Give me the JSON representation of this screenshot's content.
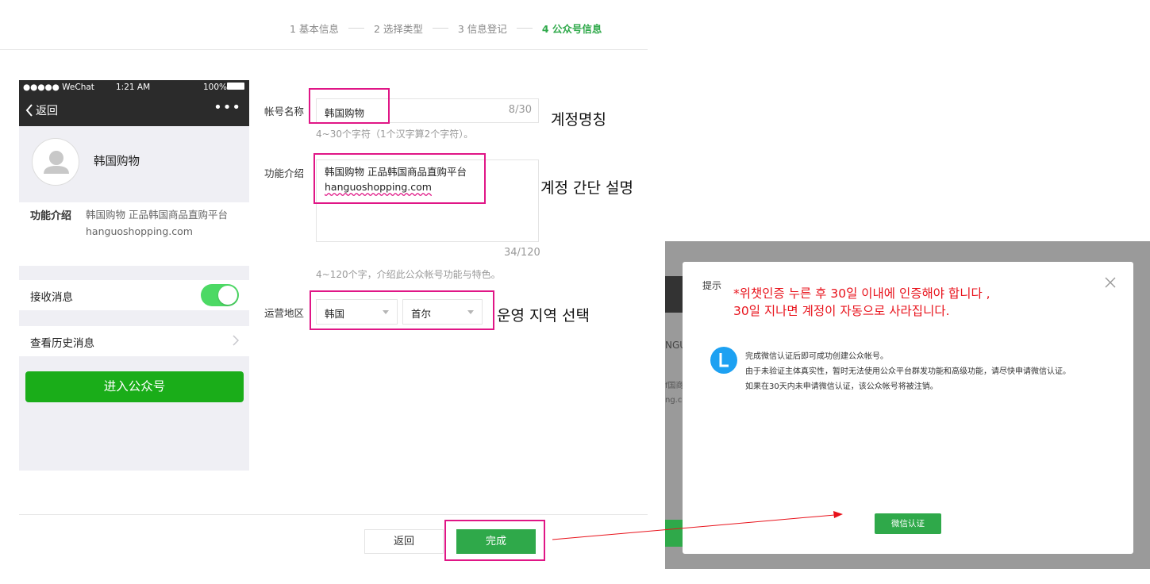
{
  "stepper": {
    "step1": "1 基本信息",
    "step2": "2 选择类型",
    "step3": "3 信息登记",
    "step4": "4 公众号信息"
  },
  "phone": {
    "carrier": "●●●●● WeChat",
    "time": "1:21 AM",
    "battery": "100%",
    "back_label": "返回",
    "more": "•••",
    "account_name": "韩国购物",
    "intro_label": "功能介绍",
    "intro_line1": "韩国购物 正品韩国商品直购平台",
    "intro_line2": "hanguoshopping.com",
    "receive_messages": "接收消息",
    "toggle_on": true,
    "history": "查看历史消息",
    "enter_button": "进入公众号"
  },
  "form": {
    "name_label": "帐号名称",
    "name_value": "韩国购物",
    "name_counter": "8/30",
    "name_hint": "4~30个字符（1个汉字算2个字符）。",
    "intro_label": "功能介绍",
    "intro_line1": "韩国购物 正品韩国商品直购平台",
    "intro_line2": "hanguoshopping.com",
    "intro_counter": "34/120",
    "intro_hint": "4~120个字，介绍此公众帐号功能与特色。",
    "region_label": "运营地区",
    "country": "韩国",
    "city": "首尔",
    "back_button": "返回",
    "done_button": "完成"
  },
  "annotations": {
    "name_note": "계정명칭",
    "intro_note": "계정 간단 설명",
    "region_note": "운영 지역 선택"
  },
  "dialog": {
    "title": "提示",
    "warning_line1": "*위챗인증 누른 후 30일 이내에 인증해야 합니다 ,",
    "warning_line2": "30일 지나면 계정이 자동으로 사라집니다.",
    "body_line1": "完成微信认证后即可成功创建公众帐号。",
    "body_line2": "由于未验证主体真实性，暂时无法使用公众平台群发功能和高级功能，请尽快申请微信认证。",
    "body_line3": "如果在30天内未申请微信认证，该公众帐号将被注销。",
    "button": "微信认证",
    "bg_text1": "NGU",
    "bg_text2": "f国商",
    "bg_text3": "ng.co"
  },
  "colors": {
    "accent_green": "#2fa94a",
    "highlight_pink": "#e01686",
    "warning_red": "#e8121b",
    "info_blue": "#1da1f2"
  }
}
